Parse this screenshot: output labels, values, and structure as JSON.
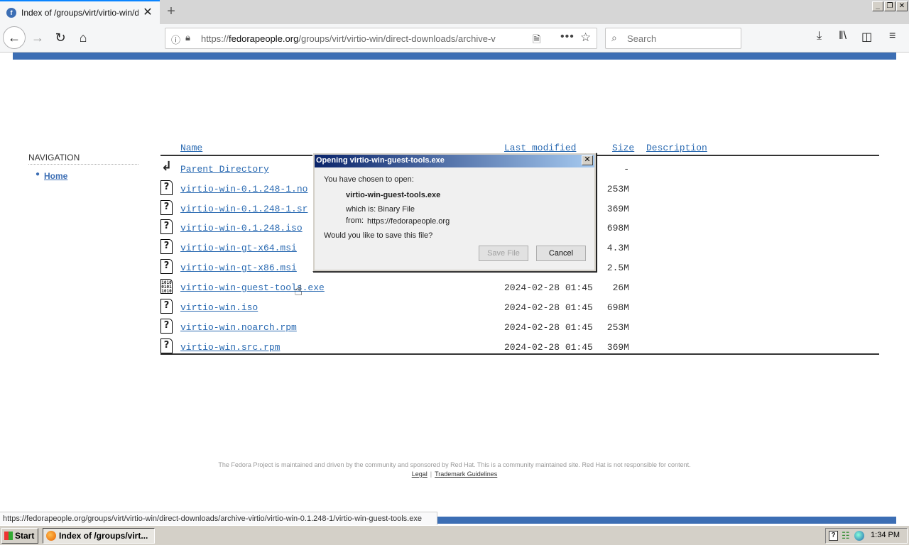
{
  "browser": {
    "tab_title": "Index of /groups/virt/virtio-win/direct-downloads/archive-virtio",
    "tab_favicon": "fedora-icon",
    "new_tab": "+",
    "tab_close": "✕",
    "window_controls": {
      "minimize": "_",
      "restore": "❐",
      "close": "✕"
    },
    "url_host": "fedorapeople.org",
    "url_prefix": "https://",
    "url_path": "/groups/virt/virtio-win/direct-downloads/archive-v",
    "search_placeholder": "Search"
  },
  "page": {
    "nav_heading": "NAVIGATION",
    "nav_home": "Home",
    "columns": {
      "name": "Name",
      "modified": "Last modified",
      "size": "Size",
      "description": "Description"
    },
    "rows": [
      {
        "icon": "back-arrow-icon",
        "name": "Parent Directory",
        "date": "",
        "size": "-"
      },
      {
        "icon": "unknown-file-icon",
        "name": "virtio-win-0.1.248-1.no",
        "date": "",
        "size": "253M"
      },
      {
        "icon": "unknown-file-icon",
        "name": "virtio-win-0.1.248-1.sr",
        "date": "",
        "size": "369M"
      },
      {
        "icon": "unknown-file-icon",
        "name": "virtio-win-0.1.248.iso",
        "date": "",
        "size": "698M"
      },
      {
        "icon": "unknown-file-icon",
        "name": "virtio-win-gt-x64.msi",
        "date": "",
        "size": "4.3M"
      },
      {
        "icon": "unknown-file-icon",
        "name": "virtio-win-gt-x86.msi",
        "date": "",
        "size": "2.5M"
      },
      {
        "icon": "binary-file-icon",
        "name": "virtio-win-guest-tools.exe",
        "date": "2024-02-28 01:45",
        "size": "26M"
      },
      {
        "icon": "unknown-file-icon",
        "name": "virtio-win.iso",
        "date": "2024-02-28 01:45",
        "size": "698M"
      },
      {
        "icon": "unknown-file-icon",
        "name": "virtio-win.noarch.rpm",
        "date": "2024-02-28 01:45",
        "size": "253M"
      },
      {
        "icon": "unknown-file-icon",
        "name": "virtio-win.src.rpm",
        "date": "2024-02-28 01:45",
        "size": "369M"
      }
    ],
    "footer_text": "The Fedora Project is maintained and driven by the community and sponsored by Red Hat. This is a community maintained site. Red Hat is not responsible for content.",
    "footer_legal": "Legal",
    "footer_trademark": "Trademark Guidelines"
  },
  "dialog": {
    "title": "Opening virtio-win-guest-tools.exe",
    "chosen": "You have chosen to open:",
    "filename": "virtio-win-guest-tools.exe",
    "which_is_label": "which is:",
    "which_is_value": "Binary File",
    "from_label": "from:",
    "from_value": "https://fedorapeople.org",
    "question": "Would you like to save this file?",
    "save_label": "Save File",
    "cancel_label": "Cancel",
    "close": "✕"
  },
  "statusbar": {
    "text": "https://fedorapeople.org/groups/virt/virtio-win/direct-downloads/archive-virtio/virtio-win-0.1.248-1/virtio-win-guest-tools.exe"
  },
  "taskbar": {
    "start_label": "Start",
    "task_label": "Index of /groups/virt...",
    "clock": "1:34 PM",
    "tray_help": "?"
  },
  "colors": {
    "accent_blue": "#3c6eb4",
    "link": "#2a6ab2",
    "dialog_title": "#0a246a"
  }
}
